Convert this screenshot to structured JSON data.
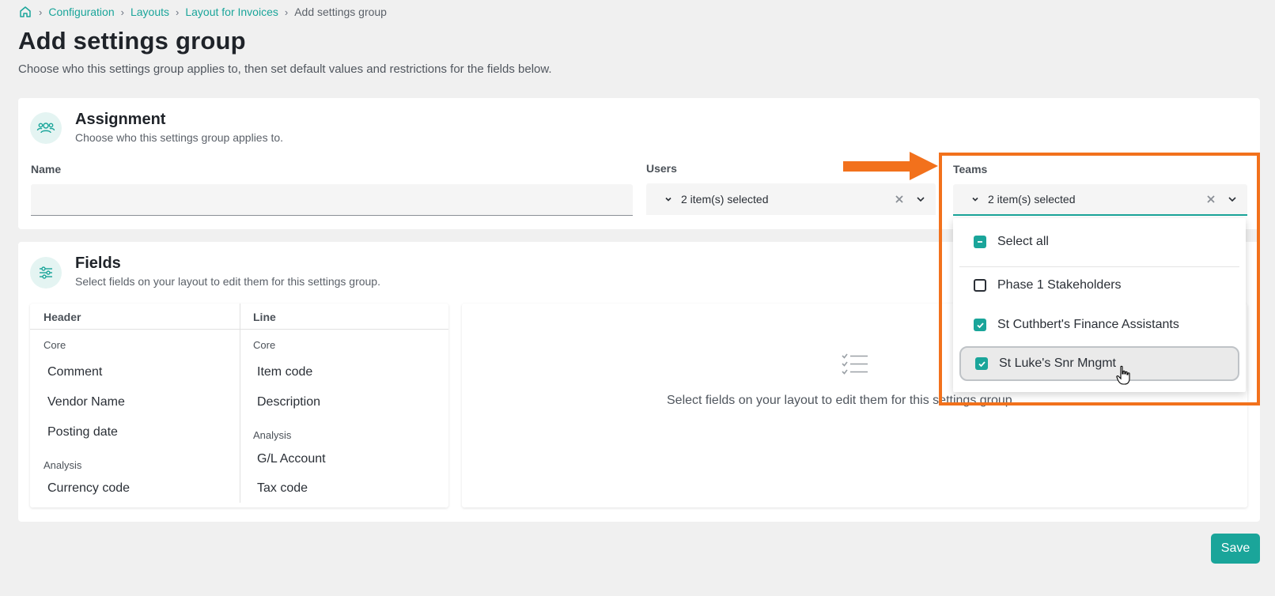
{
  "breadcrumb": {
    "items": [
      "Configuration",
      "Layouts",
      "Layout for Invoices"
    ],
    "current": "Add settings group",
    "separator": "›"
  },
  "page": {
    "title": "Add settings group",
    "subtitle": "Choose who this settings group applies to, then set default values and restrictions for the fields below."
  },
  "assignment": {
    "title": "Assignment",
    "description": "Choose who this settings group applies to.",
    "name_label": "Name",
    "name_value": "",
    "users_label": "Users",
    "users_value": "2 item(s) selected",
    "teams_label": "Teams",
    "teams_value": "2 item(s) selected"
  },
  "teams_dropdown": {
    "select_all": "Select all",
    "options": [
      {
        "label": "Phase 1 Stakeholders",
        "checked": false
      },
      {
        "label": "St Cuthbert's Finance Assistants",
        "checked": true
      },
      {
        "label": "St Luke's Snr Mngmt",
        "checked": true
      }
    ]
  },
  "fields": {
    "title": "Fields",
    "description": "Select fields on your layout to edit them for this settings group.",
    "header_col": "Header",
    "line_col": "Line",
    "header_groups": {
      "core_label": "Core",
      "core_items": [
        "Comment",
        "Vendor Name",
        "Posting date"
      ],
      "analysis_label": "Analysis",
      "analysis_items": [
        "Currency code"
      ]
    },
    "line_groups": {
      "core_label": "Core",
      "core_items": [
        "Item code",
        "Description"
      ],
      "analysis_label": "Analysis",
      "analysis_items": [
        "G/L Account",
        "Tax code"
      ]
    },
    "empty_message": "Select fields on your layout to edit them for this settings group."
  },
  "actions": {
    "save_label": "Save"
  },
  "colors": {
    "accent": "#1aa59a",
    "annotation": "#f2711c",
    "background": "#f0f0f0"
  },
  "icons": {
    "home": "home-icon",
    "assignment": "users-group-icon",
    "fields": "sliders-icon",
    "empty": "checklist-icon",
    "annotation_arrow": "arrow-right-icon",
    "cursor": "hand-pointer-icon"
  }
}
